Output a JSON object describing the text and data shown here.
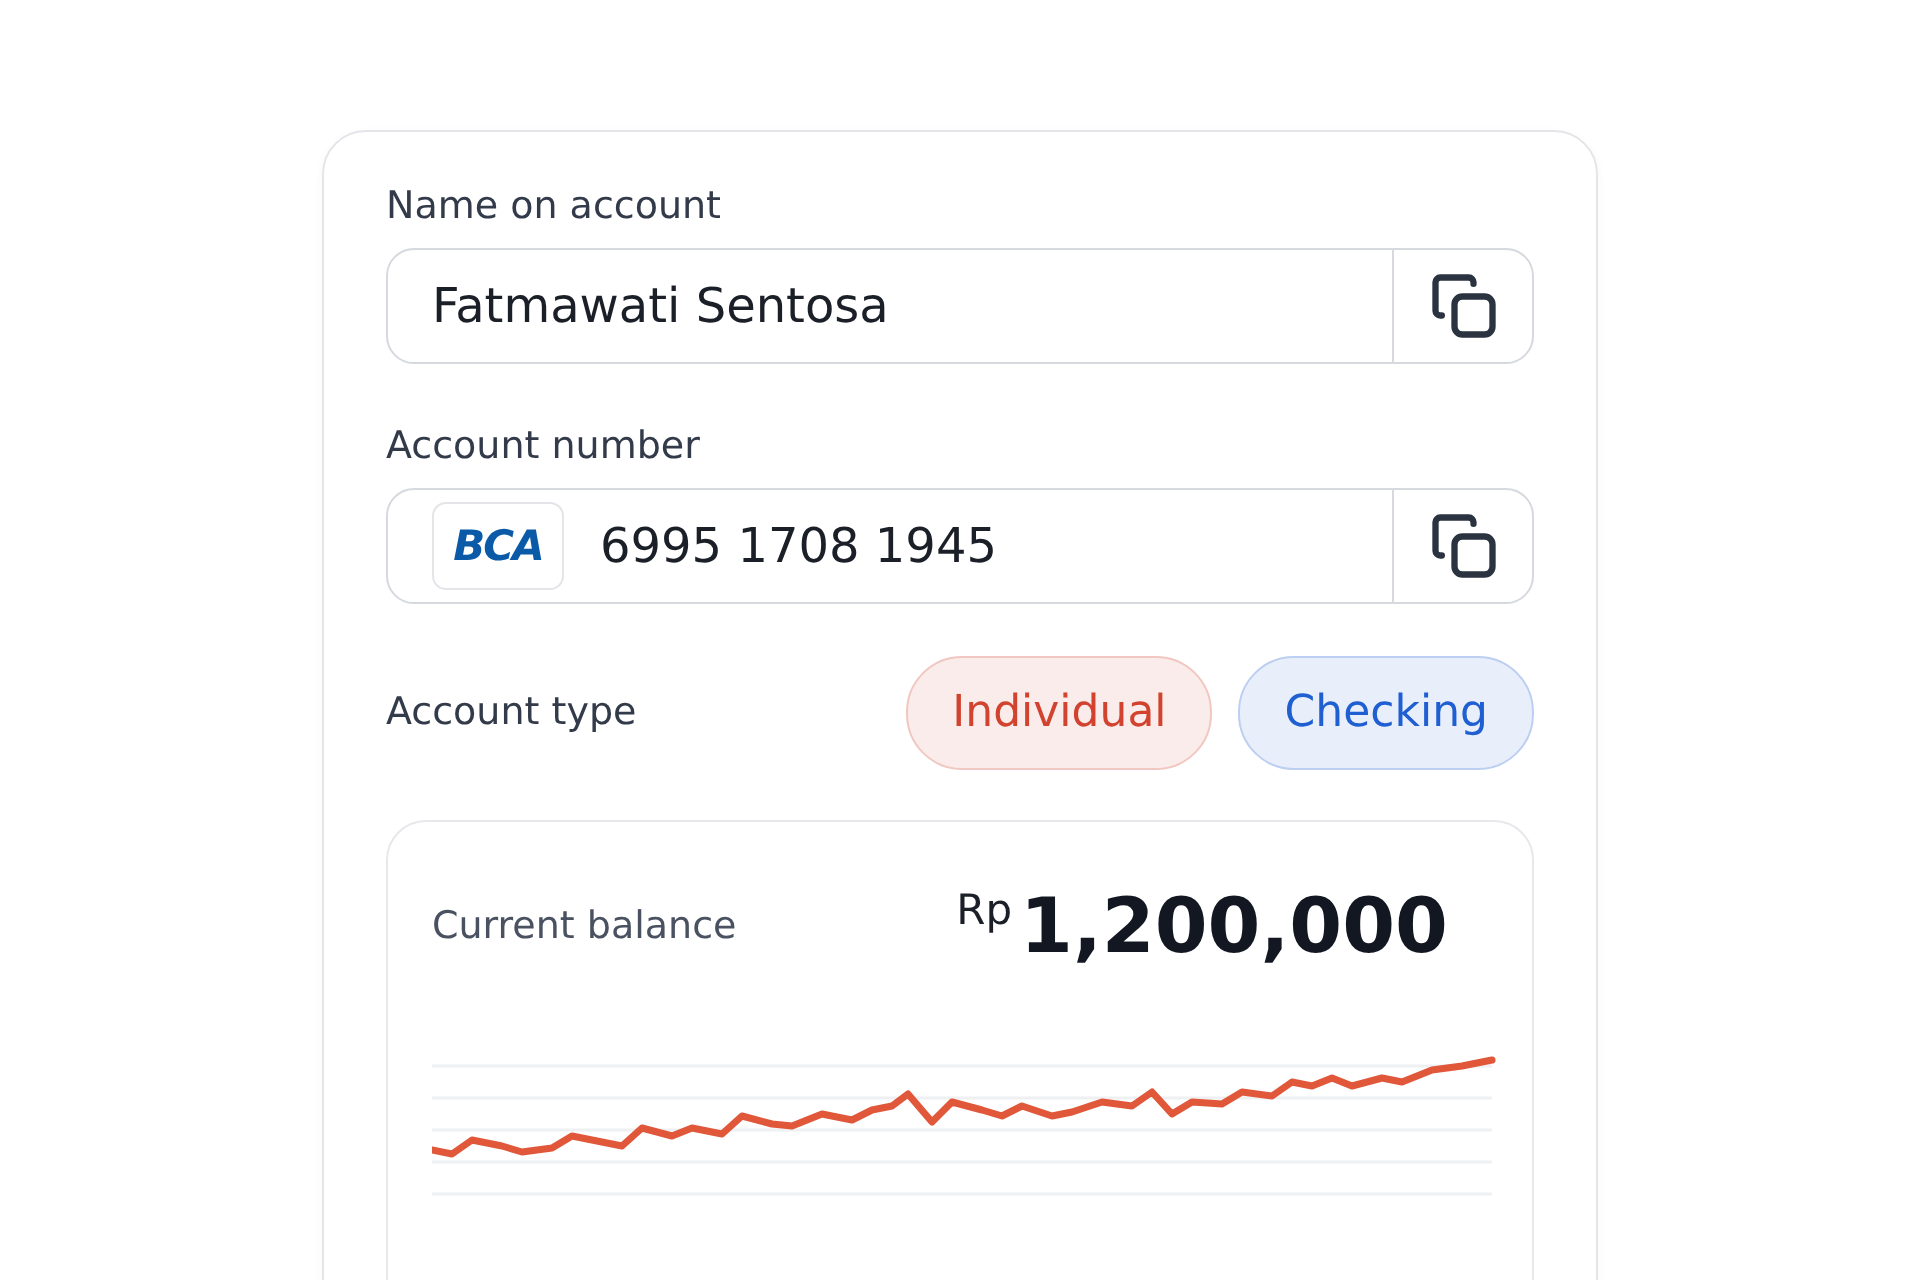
{
  "name_field": {
    "label": "Name on account",
    "value": "Fatmawati Sentosa"
  },
  "number_field": {
    "label": "Account number",
    "bank_logo": "BCA",
    "value": "6995 1708 1945"
  },
  "account_type": {
    "label": "Account type",
    "tags": [
      {
        "label": "Individual",
        "color": "#d1432f"
      },
      {
        "label": "Checking",
        "color": "#1f5fd1"
      }
    ]
  },
  "balance": {
    "label": "Current balance",
    "currency": "Rp",
    "amount": "1,200,000"
  }
}
